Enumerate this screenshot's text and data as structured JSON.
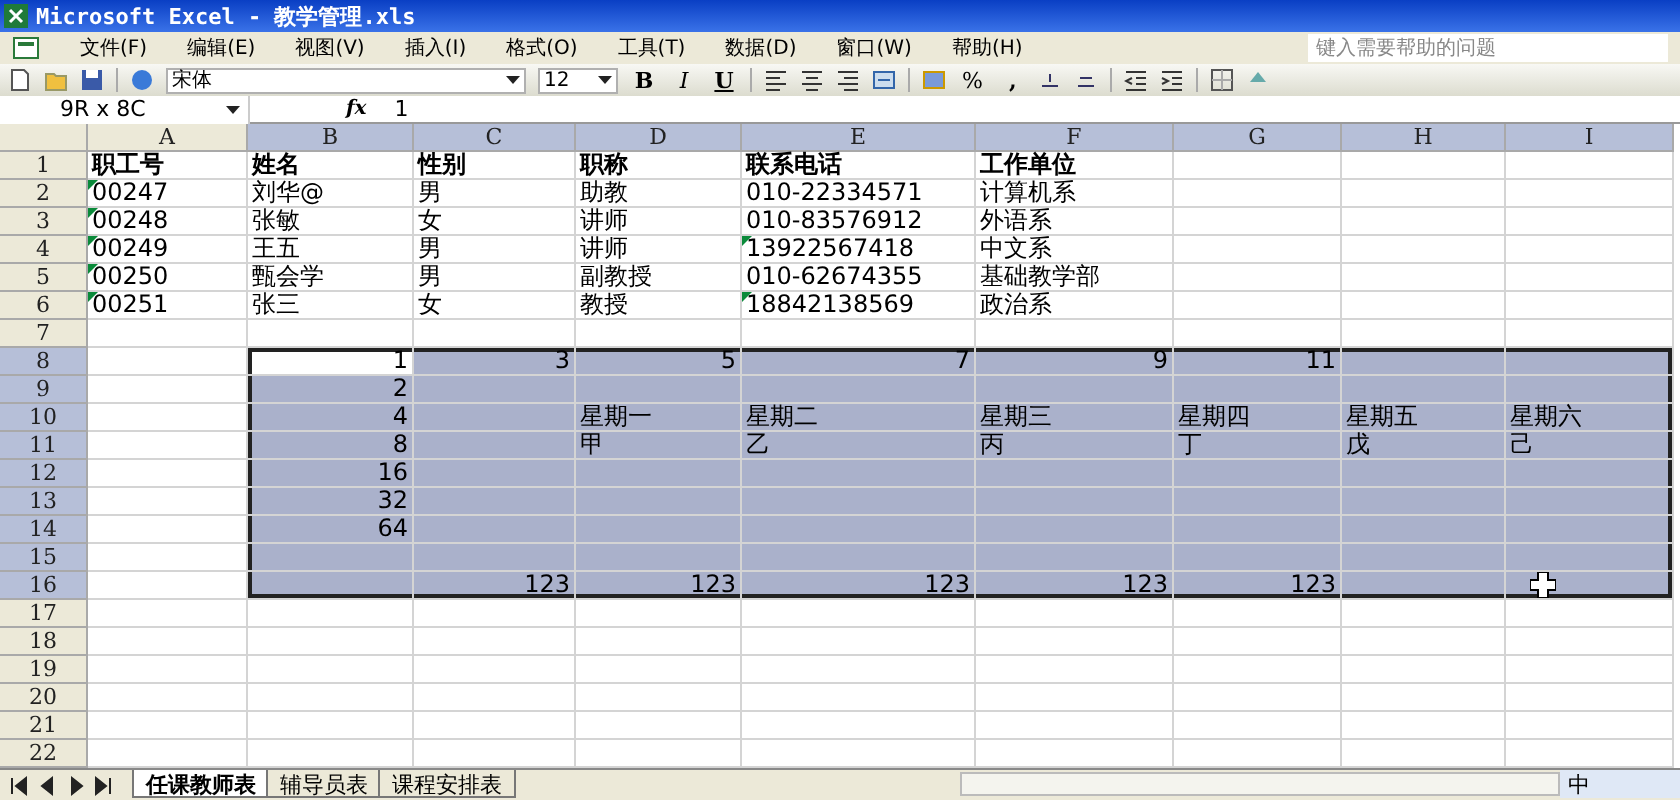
{
  "window": {
    "title": "Microsoft Excel - 教学管理.xls"
  },
  "menu": [
    "文件(F)",
    "编辑(E)",
    "视图(V)",
    "插入(I)",
    "格式(O)",
    "工具(T)",
    "数据(D)",
    "窗口(W)",
    "帮助(H)"
  ],
  "help_search": {
    "placeholder": "键入需要帮助的问题"
  },
  "toolbar": {
    "font": "宋体",
    "size": "12",
    "bold": "B",
    "italic": "I",
    "underline": "U",
    "percent": "%",
    "comma": ","
  },
  "formula_bar": {
    "name_box": "9R x 8C",
    "fx": "fx",
    "value": "1"
  },
  "columns": [
    {
      "label": "A",
      "selected": false
    },
    {
      "label": "B",
      "selected": true
    },
    {
      "label": "C",
      "selected": true
    },
    {
      "label": "D",
      "selected": true
    },
    {
      "label": "E",
      "selected": true
    },
    {
      "label": "F",
      "selected": true
    },
    {
      "label": "G",
      "selected": true
    },
    {
      "label": "H",
      "selected": true
    },
    {
      "label": "I",
      "selected": true
    }
  ],
  "rows": [
    {
      "number": "1",
      "selected": false,
      "cells": {
        "A": {
          "text": "职工号",
          "kind": "header",
          "marked": false
        },
        "B": {
          "text": "姓名",
          "kind": "header",
          "marked": false
        },
        "C": {
          "text": "性别",
          "kind": "header",
          "marked": false
        },
        "D": {
          "text": "职称",
          "kind": "header",
          "marked": false
        },
        "E": {
          "text": "联系电话",
          "kind": "header",
          "marked": false
        },
        "F": {
          "text": "工作单位",
          "kind": "header",
          "marked": false
        }
      }
    },
    {
      "number": "2",
      "selected": false,
      "cells": {
        "A": {
          "text": "00247",
          "kind": "text",
          "marked": true
        },
        "B": {
          "text": "刘华@",
          "kind": "text",
          "marked": false
        },
        "C": {
          "text": "男",
          "kind": "text",
          "marked": false
        },
        "D": {
          "text": "助教",
          "kind": "text",
          "marked": false
        },
        "E": {
          "text": "010-22334571",
          "kind": "text",
          "marked": false
        },
        "F": {
          "text": "计算机系",
          "kind": "text",
          "marked": false
        }
      }
    },
    {
      "number": "3",
      "selected": false,
      "cells": {
        "A": {
          "text": "00248",
          "kind": "text",
          "marked": true
        },
        "B": {
          "text": "张敏",
          "kind": "text",
          "marked": false
        },
        "C": {
          "text": "女",
          "kind": "text",
          "marked": false
        },
        "D": {
          "text": "讲师",
          "kind": "text",
          "marked": false
        },
        "E": {
          "text": "010-83576912",
          "kind": "text",
          "marked": false
        },
        "F": {
          "text": "外语系",
          "kind": "text",
          "marked": false
        }
      }
    },
    {
      "number": "4",
      "selected": false,
      "cells": {
        "A": {
          "text": "00249",
          "kind": "text",
          "marked": true
        },
        "B": {
          "text": "王五",
          "kind": "text",
          "marked": false
        },
        "C": {
          "text": "男",
          "kind": "text",
          "marked": false
        },
        "D": {
          "text": "讲师",
          "kind": "text",
          "marked": false
        },
        "E": {
          "text": "13922567418",
          "kind": "text",
          "marked": true
        },
        "F": {
          "text": "中文系",
          "kind": "text",
          "marked": false
        }
      }
    },
    {
      "number": "5",
      "selected": false,
      "cells": {
        "A": {
          "text": "00250",
          "kind": "text",
          "marked": true
        },
        "B": {
          "text": "甄会学",
          "kind": "text",
          "marked": false
        },
        "C": {
          "text": "男",
          "kind": "text",
          "marked": false
        },
        "D": {
          "text": "副教授",
          "kind": "text",
          "marked": false
        },
        "E": {
          "text": "010-62674355",
          "kind": "text",
          "marked": false
        },
        "F": {
          "text": "基础教学部",
          "kind": "text",
          "marked": false
        }
      }
    },
    {
      "number": "6",
      "selected": false,
      "cells": {
        "A": {
          "text": "00251",
          "kind": "text",
          "marked": true
        },
        "B": {
          "text": "张三",
          "kind": "text",
          "marked": false
        },
        "C": {
          "text": "女",
          "kind": "text",
          "marked": false
        },
        "D": {
          "text": "教授",
          "kind": "text",
          "marked": false
        },
        "E": {
          "text": "18842138569",
          "kind": "text",
          "marked": true
        },
        "F": {
          "text": "政治系",
          "kind": "text",
          "marked": false
        }
      }
    },
    {
      "number": "7",
      "selected": false,
      "cells": {}
    },
    {
      "number": "8",
      "selected": true,
      "cells": {
        "B": {
          "text": "1",
          "kind": "number",
          "marked": false
        },
        "C": {
          "text": "3",
          "kind": "number",
          "marked": false
        },
        "D": {
          "text": "5",
          "kind": "number",
          "marked": false
        },
        "E": {
          "text": "7",
          "kind": "number",
          "marked": false
        },
        "F": {
          "text": "9",
          "kind": "number",
          "marked": false
        },
        "G": {
          "text": "11",
          "kind": "number",
          "marked": false
        }
      }
    },
    {
      "number": "9",
      "selected": true,
      "cells": {
        "B": {
          "text": "2",
          "kind": "number",
          "marked": false
        }
      }
    },
    {
      "number": "10",
      "selected": true,
      "cells": {
        "B": {
          "text": "4",
          "kind": "number",
          "marked": false
        },
        "D": {
          "text": "星期一",
          "kind": "text",
          "marked": false
        },
        "E": {
          "text": "星期二",
          "kind": "text",
          "marked": false
        },
        "F": {
          "text": "星期三",
          "kind": "text",
          "marked": false
        },
        "G": {
          "text": "星期四",
          "kind": "text",
          "marked": false
        },
        "H": {
          "text": "星期五",
          "kind": "text",
          "marked": false
        },
        "I": {
          "text": "星期六",
          "kind": "text",
          "marked": false
        }
      }
    },
    {
      "number": "11",
      "selected": true,
      "cells": {
        "B": {
          "text": "8",
          "kind": "number",
          "marked": false
        },
        "D": {
          "text": "甲",
          "kind": "text",
          "marked": false
        },
        "E": {
          "text": "乙",
          "kind": "text",
          "marked": false
        },
        "F": {
          "text": "丙",
          "kind": "text",
          "marked": false
        },
        "G": {
          "text": "丁",
          "kind": "text",
          "marked": false
        },
        "H": {
          "text": "戊",
          "kind": "text",
          "marked": false
        },
        "I": {
          "text": "己",
          "kind": "text",
          "marked": false
        }
      }
    },
    {
      "number": "12",
      "selected": true,
      "cells": {
        "B": {
          "text": "16",
          "kind": "number",
          "marked": false
        }
      }
    },
    {
      "number": "13",
      "selected": true,
      "cells": {
        "B": {
          "text": "32",
          "kind": "number",
          "marked": false
        }
      }
    },
    {
      "number": "14",
      "selected": true,
      "cells": {
        "B": {
          "text": "64",
          "kind": "number",
          "marked": false
        }
      }
    },
    {
      "number": "15",
      "selected": true,
      "cells": {}
    },
    {
      "number": "16",
      "selected": true,
      "cells": {
        "C": {
          "text": "123",
          "kind": "number",
          "marked": false
        },
        "D": {
          "text": "123",
          "kind": "number",
          "marked": false
        },
        "E": {
          "text": "123",
          "kind": "number",
          "marked": false
        },
        "F": {
          "text": "123",
          "kind": "number",
          "marked": false
        },
        "G": {
          "text": "123",
          "kind": "number",
          "marked": false
        }
      }
    },
    {
      "number": "17",
      "selected": false,
      "cells": {}
    },
    {
      "number": "18",
      "selected": false,
      "cells": {}
    },
    {
      "number": "19",
      "selected": false,
      "cells": {}
    },
    {
      "number": "20",
      "selected": false,
      "cells": {}
    },
    {
      "number": "21",
      "selected": false,
      "cells": {}
    },
    {
      "number": "22",
      "selected": false,
      "cells": {}
    }
  ],
  "sheet_tabs": [
    {
      "label": "任课教师表",
      "selected": true
    },
    {
      "label": "辅导员表",
      "selected": false
    },
    {
      "label": "课程安排表",
      "selected": false
    }
  ],
  "ime_bar": {
    "label": "中"
  }
}
